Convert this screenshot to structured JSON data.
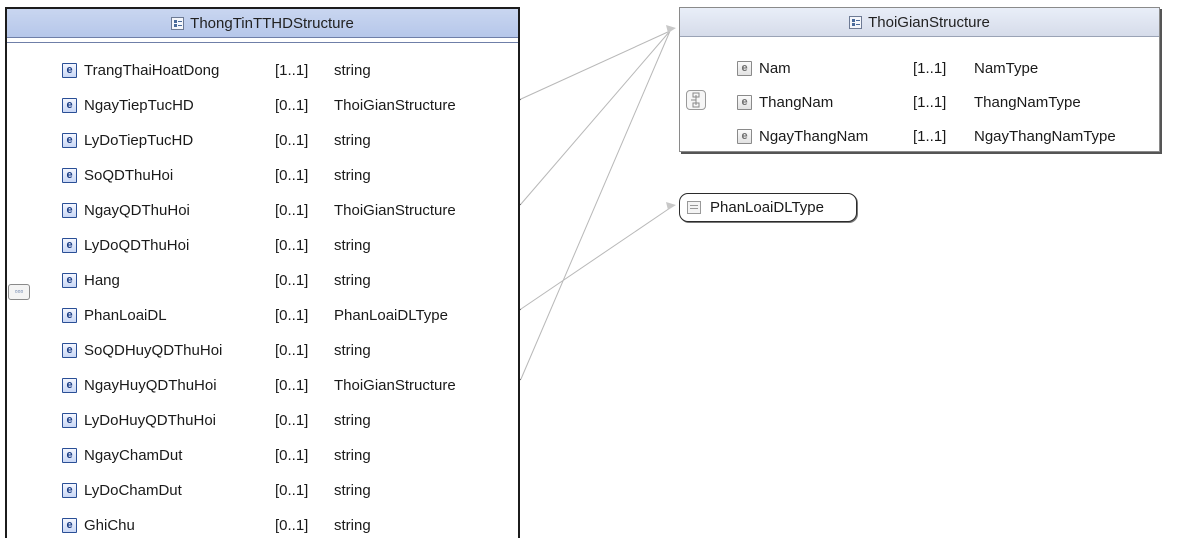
{
  "main": {
    "title": "ThongTinTTHDStructure",
    "rows": [
      {
        "name": "TrangThaiHoatDong",
        "card": "[1..1]",
        "type": "string"
      },
      {
        "name": "NgayTiepTucHD",
        "card": "[0..1]",
        "type": "ThoiGianStructure"
      },
      {
        "name": "LyDoTiepTucHD",
        "card": "[0..1]",
        "type": "string"
      },
      {
        "name": "SoQDThuHoi",
        "card": "[0..1]",
        "type": "string"
      },
      {
        "name": "NgayQDThuHoi",
        "card": "[0..1]",
        "type": "ThoiGianStructure"
      },
      {
        "name": "LyDoQDThuHoi",
        "card": "[0..1]",
        "type": "string"
      },
      {
        "name": "Hang",
        "card": "[0..1]",
        "type": "string"
      },
      {
        "name": "PhanLoaiDL",
        "card": "[0..1]",
        "type": "PhanLoaiDLType"
      },
      {
        "name": "SoQDHuyQDThuHoi",
        "card": "[0..1]",
        "type": "string"
      },
      {
        "name": "NgayHuyQDThuHoi",
        "card": "[0..1]",
        "type": "ThoiGianStructure"
      },
      {
        "name": "LyDoHuyQDThuHoi",
        "card": "[0..1]",
        "type": "string"
      },
      {
        "name": "NgayChamDut",
        "card": "[0..1]",
        "type": "string"
      },
      {
        "name": "LyDoChamDut",
        "card": "[0..1]",
        "type": "string"
      },
      {
        "name": "GhiChu",
        "card": "[0..1]",
        "type": "string"
      }
    ]
  },
  "thoigian": {
    "title": "ThoiGianStructure",
    "rows": [
      {
        "name": "Nam",
        "card": "[1..1]",
        "type": "NamType"
      },
      {
        "name": "ThangNam",
        "card": "[1..1]",
        "type": "ThangNamType"
      },
      {
        "name": "NgayThangNam",
        "card": "[1..1]",
        "type": "NgayThangNamType"
      }
    ]
  },
  "phanloai": {
    "title": "PhanLoaiDLType"
  },
  "icons": {
    "element_letter": "e",
    "sequence_glyph": "▫▫▫"
  }
}
